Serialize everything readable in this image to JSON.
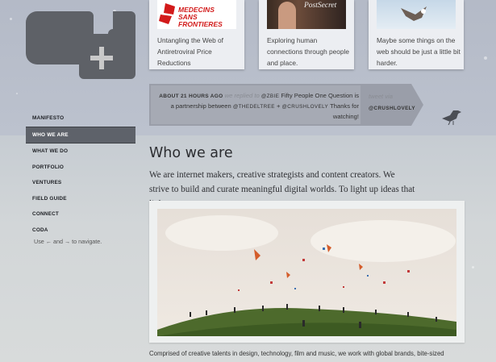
{
  "colors": {
    "nav_active": "#5e626a",
    "logo": "#5e6167",
    "tweet_bar": "#9a9ea9"
  },
  "logo": {
    "icon": "plus-icon"
  },
  "cards": [
    {
      "image_text_1": "MEDECINS",
      "image_text_2": "SANS FRONTIERES",
      "text": "Untangling the Web of Antiretroviral Price Reductions"
    },
    {
      "image_text": "PostSecret",
      "text": "Exploring human connections through people and place."
    },
    {
      "text": "Maybe some things on the web should be just a little bit harder."
    }
  ],
  "tweet": {
    "time": "ABOUT 21 HOURS AGO",
    "replied": "we replied to",
    "handle1": "@ZBIE",
    "text1": "Fifty People One Question is a partnership between",
    "handle2": "@THEDELTREE",
    "plus": "+",
    "handle3": "@CRUSHLOVELY",
    "text2": "Thanks for watching!",
    "via_label": "tweet via",
    "via_handle": "@CRUSHLOVELY",
    "icon": "bird-icon"
  },
  "nav": {
    "items": [
      "MANIFESTO",
      "WHO WE ARE",
      "WHAT WE DO",
      "PORTFOLIO",
      "VENTURES",
      "FIELD GUIDE",
      "CONNECT",
      "CODA"
    ],
    "hint": "Use ← and → to navigate."
  },
  "main": {
    "title": "Who we are",
    "intro": "We are internet makers, creative strategists and content creators. We strive to build and curate meaningful digital worlds. To light up ideas that light you up.",
    "body": "Comprised of creative talents in design, technology, film and music, we work with global brands, bite-sized"
  }
}
